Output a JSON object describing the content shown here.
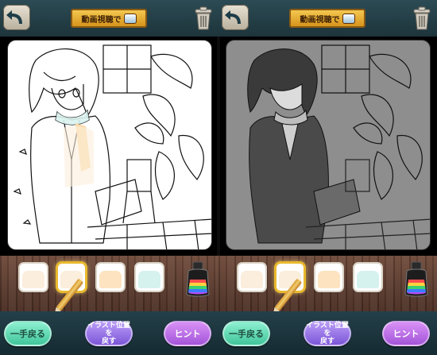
{
  "toolbar": {
    "back_icon": "undo-arrow-icon",
    "trash_icon": "trash-icon",
    "video_label": "動画視聴で",
    "video_reward_icon": "ink-chest-icon"
  },
  "palette": {
    "swatches": [
      {
        "color": "#fbeedc"
      },
      {
        "color": "#fbeedc",
        "selected": true
      },
      {
        "color": "#fde3c0"
      },
      {
        "color": "#d5f2ee"
      }
    ],
    "extra_icon": "rainbow-ink-bottle-icon"
  },
  "buttons": {
    "undo": "一手戻る",
    "reset_line1": "イラスト位置を",
    "reset_line2": "戻す",
    "hint": "ヒント"
  },
  "panels": [
    {
      "mode": "color",
      "canvas_bg": "#ffffff",
      "stroke": "#111111"
    },
    {
      "mode": "gray",
      "canvas_bg": "#8e8e8e",
      "stroke": "#111111"
    }
  ],
  "colors": {
    "topbar": "#243f47",
    "wood": "#5b3b2e",
    "gold": "#e9b92f"
  }
}
